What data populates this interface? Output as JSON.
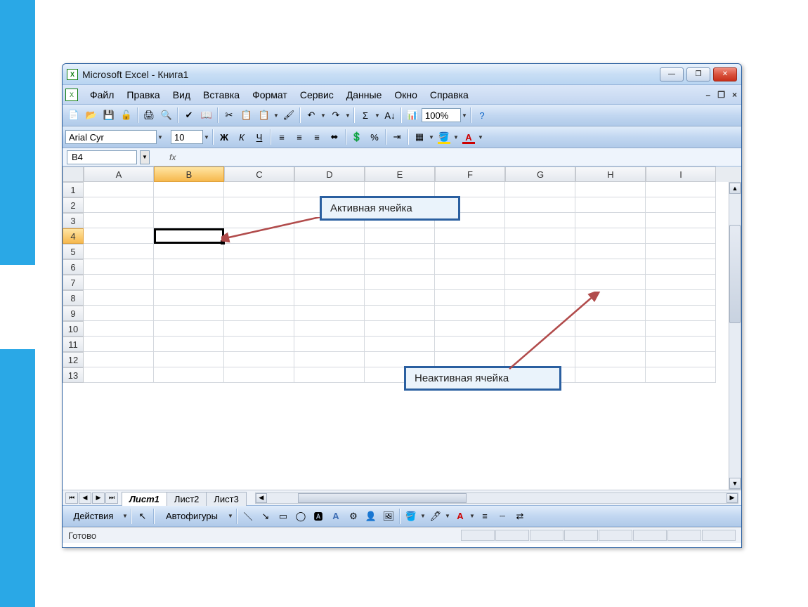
{
  "titlebar": {
    "title": "Microsoft Excel - Книга1"
  },
  "menu": {
    "items": [
      "Файл",
      "Правка",
      "Вид",
      "Вставка",
      "Формат",
      "Сервис",
      "Данные",
      "Окно",
      "Справка"
    ]
  },
  "toolbar": {
    "zoom": "100%"
  },
  "format": {
    "font_name": "Arial Cyr",
    "font_size": "10"
  },
  "formula": {
    "name_box": "B4",
    "fx_label": "fx"
  },
  "grid": {
    "columns": [
      "A",
      "B",
      "C",
      "D",
      "E",
      "F",
      "G",
      "H",
      "I"
    ],
    "rows": [
      "1",
      "2",
      "3",
      "4",
      "5",
      "6",
      "7",
      "8",
      "9",
      "10",
      "11",
      "12",
      "13"
    ],
    "active_cell": "B4",
    "selected_col": "B",
    "selected_row": "4"
  },
  "callouts": {
    "active": "Активная ячейка",
    "inactive": "Неактивная ячейка"
  },
  "sheets": {
    "tabs": [
      "Лист1",
      "Лист2",
      "Лист3"
    ],
    "active": "Лист1"
  },
  "draw": {
    "actions": "Действия",
    "autoshapes": "Автофигуры"
  },
  "status": {
    "ready": "Готово"
  }
}
